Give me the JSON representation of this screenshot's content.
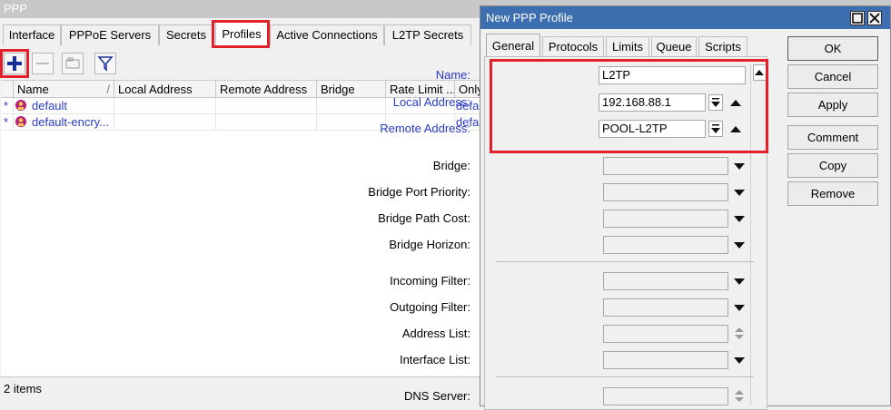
{
  "ppp_window": {
    "title": "PPP",
    "tabs": [
      "Interface",
      "PPPoE Servers",
      "Secrets",
      "Profiles",
      "Active Connections",
      "L2TP Secrets"
    ],
    "active_tab": "Profiles",
    "toolbar": {
      "add": "add-icon",
      "remove": "remove-icon",
      "comment": "comment-icon",
      "filter": "filter-icon"
    },
    "columns": [
      "Name",
      "Local Address",
      "Remote Address",
      "Bridge",
      "Rate Limit ...",
      "Only"
    ],
    "rows": [
      {
        "flag": "*",
        "icon": "profile-icon",
        "name": "default",
        "local": "",
        "remote": "",
        "bridge": "",
        "rate": "",
        "only": "defa"
      },
      {
        "flag": "*",
        "icon": "profile-icon",
        "name": "default-encry...",
        "local": "",
        "remote": "",
        "bridge": "",
        "rate": "",
        "only": "defa"
      }
    ],
    "status": "2 items"
  },
  "dialog": {
    "title": "New PPP Profile",
    "tabs": [
      "General",
      "Protocols",
      "Limits",
      "Queue",
      "Scripts"
    ],
    "active_tab": "General",
    "fields": {
      "name": {
        "label": "Name:",
        "value": "L2TP"
      },
      "local_address": {
        "label": "Local Address:",
        "value": "192.168.88.1"
      },
      "remote_address": {
        "label": "Remote Address:",
        "value": "POOL-L2TP"
      },
      "bridge": {
        "label": "Bridge:",
        "value": ""
      },
      "bridge_port_priority": {
        "label": "Bridge Port Priority:",
        "value": ""
      },
      "bridge_path_cost": {
        "label": "Bridge Path Cost:",
        "value": ""
      },
      "bridge_horizon": {
        "label": "Bridge Horizon:",
        "value": ""
      },
      "incoming_filter": {
        "label": "Incoming Filter:",
        "value": ""
      },
      "outgoing_filter": {
        "label": "Outgoing Filter:",
        "value": ""
      },
      "address_list": {
        "label": "Address List:",
        "value": ""
      },
      "interface_list": {
        "label": "Interface List:",
        "value": ""
      },
      "dns_server": {
        "label": "DNS Server:",
        "value": ""
      }
    },
    "buttons": {
      "ok": "OK",
      "cancel": "Cancel",
      "apply": "Apply",
      "comment": "Comment",
      "copy": "Copy",
      "remove": "Remove"
    }
  },
  "colors": {
    "highlight": "#e3202a",
    "dialog_titlebar": "#3d6fb0",
    "link_text": "#2a3cc4"
  }
}
